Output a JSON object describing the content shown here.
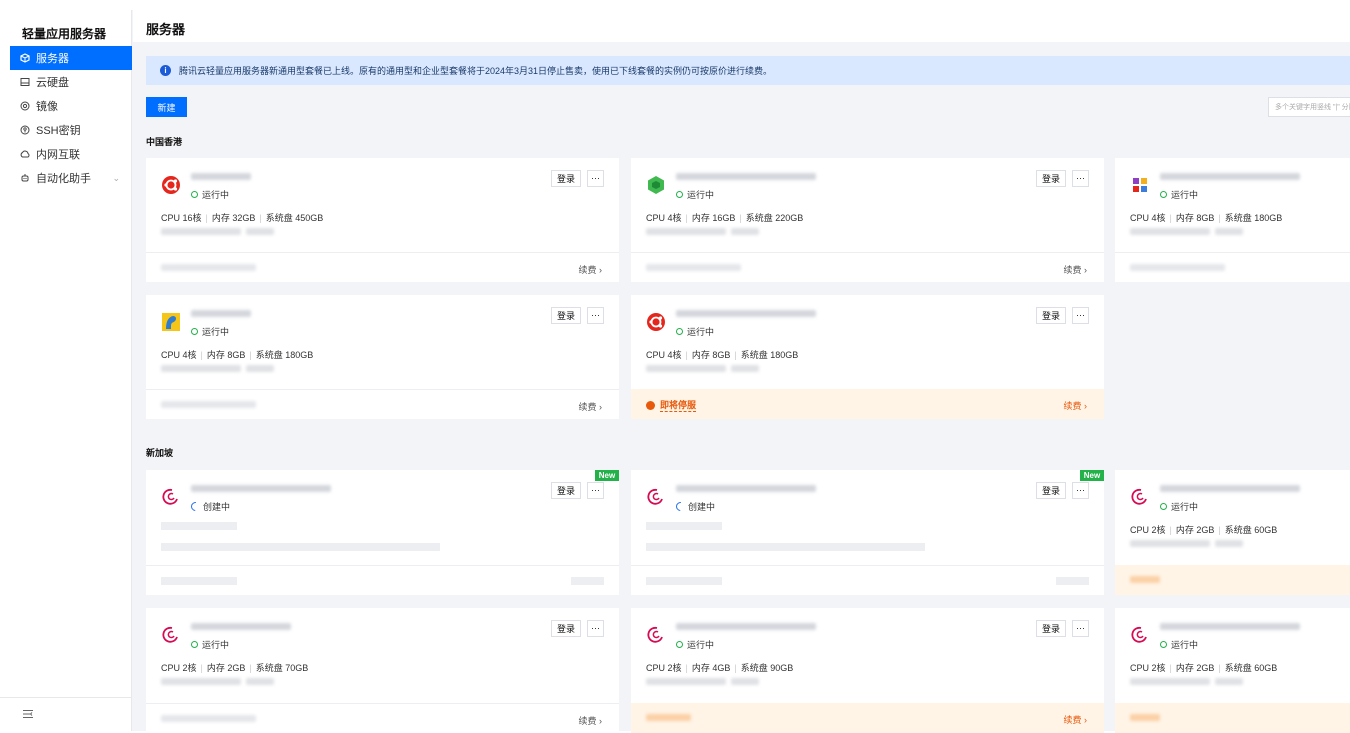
{
  "sidebar": {
    "title": "轻量应用服务器",
    "items": [
      {
        "label": "服务器",
        "icon": "server-icon"
      },
      {
        "label": "云硬盘",
        "icon": "disk-icon"
      },
      {
        "label": "镜像",
        "icon": "image-icon"
      },
      {
        "label": "SSH密钥",
        "icon": "key-icon"
      },
      {
        "label": "内网互联",
        "icon": "network-icon"
      },
      {
        "label": "自动化助手",
        "icon": "assistant-icon"
      }
    ],
    "expand_arrow": "⌄",
    "active_color": "#006eff"
  },
  "header": {
    "title": "服务器"
  },
  "notice": {
    "icon": "i",
    "text": "腾讯云轻量应用服务器新通用型套餐已上线。原有的通用型和企业型套餐将于2024年3月31日停止售卖，使用已下线套餐的实例仍可按原价进行续费。"
  },
  "toolbar": {
    "new_label": "新建",
    "search_placeholder": "多个关键字用竖线 \"|\" 分隔"
  },
  "regions": {
    "hk": "中国香港",
    "sg": "新加坡"
  },
  "labels": {
    "login": "登录",
    "more": "···",
    "renew": "续费 ›",
    "running": "运行中",
    "creating": "创建中",
    "expiring": "即将停服",
    "new_badge": "New",
    "cpu": "CPU",
    "mem": "内存",
    "disk": "系统盘"
  },
  "cards": {
    "hk1": {
      "cpu": "CPU 16核",
      "mem": "内存 32GB",
      "disk": "系统盘 450GB",
      "logo": "ubuntu-icon"
    },
    "hk2": {
      "cpu": "CPU 4核",
      "mem": "内存 16GB",
      "disk": "系统盘 220GB",
      "logo": "cube-icon"
    },
    "hk3": {
      "cpu": "CPU 4核",
      "mem": "内存 8GB",
      "disk": "系统盘 180GB",
      "logo": "grid-app-icon"
    },
    "hk4": {
      "cpu": "CPU 4核",
      "mem": "内存 8GB",
      "disk": "系统盘 180GB",
      "logo": "lego-icon"
    },
    "hk5": {
      "cpu": "CPU 4核",
      "mem": "内存 8GB",
      "disk": "系统盘 180GB",
      "logo": "ubuntu-icon"
    },
    "sg3": {
      "cpu": "CPU 2核",
      "mem": "内存 2GB",
      "disk": "系统盘 60GB",
      "logo": "debian-icon"
    },
    "sg4": {
      "cpu": "CPU 2核",
      "mem": "内存 2GB",
      "disk": "系统盘 70GB",
      "logo": "debian-icon"
    },
    "sg5": {
      "cpu": "CPU 2核",
      "mem": "内存 4GB",
      "disk": "系统盘 90GB",
      "logo": "debian-icon"
    },
    "sg6": {
      "cpu": "CPU 2核",
      "mem": "内存 2GB",
      "disk": "系统盘 60GB",
      "logo": "debian-icon"
    }
  },
  "colors": {
    "primary": "#006eff",
    "running": "#23b14a",
    "warning": "#e8590c",
    "new": "#23b14a"
  }
}
